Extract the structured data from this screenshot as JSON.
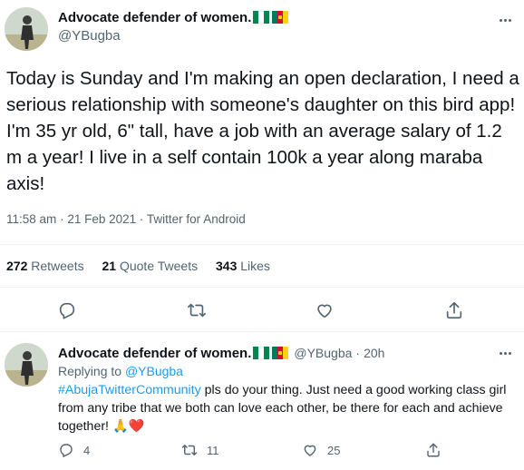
{
  "main_tweet": {
    "display_name": "Advocate defender of women.",
    "handle": "@YBugba",
    "text": "Today is Sunday and I'm making an open declaration, I need a serious relationship with someone's daughter on this bird app! I'm 35 yr old, 6\" tall, have a job with an average salary of 1.2 m a year! I live in a self contain 100k a year along maraba axis!",
    "time": "11:58 am",
    "date": "21 Feb 2021",
    "separator": "·",
    "source": "Twitter for Android",
    "stats": {
      "retweets_count": "272",
      "retweets_label": "Retweets",
      "quote_count": "21",
      "quote_label": "Quote Tweets",
      "likes_count": "343",
      "likes_label": "Likes"
    }
  },
  "reply_tweet": {
    "display_name": "Advocate defender of women.",
    "handle": "@YBugba",
    "separator": "·",
    "age": "20h",
    "replying_prefix": "Replying to",
    "replying_to": "@YBugba",
    "hashtag": "#AbujaTwitterCommunity",
    "text": " pls do your thing. Just need a good working class girl from any tribe that we both can love each other, be there for each and achieve together! ",
    "emojis": "🙏❤️",
    "reply_count": "4",
    "retweet_count": "11",
    "like_count": "25"
  },
  "colors": {
    "text": "#0f1419",
    "muted": "#536471",
    "link": "#1d9bf0",
    "divider": "#eff3f4",
    "nigeria_green": "#008751",
    "cameroon_green": "#007a5e",
    "cameroon_red": "#ce1126",
    "cameroon_yellow": "#fcd116"
  }
}
